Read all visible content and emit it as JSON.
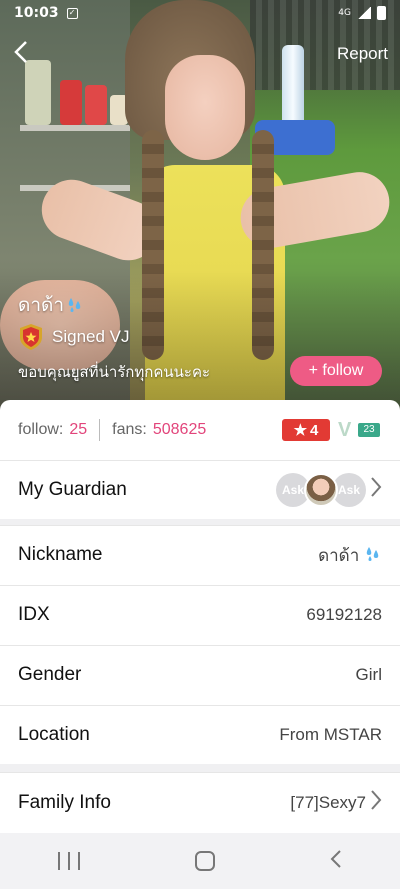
{
  "status_bar": {
    "time": "10:03",
    "network": "4G"
  },
  "header": {
    "report_label": "Report"
  },
  "profile_hero": {
    "nickname": "ดาด้า",
    "vj_label": "Signed VJ",
    "bio": "ขอบคุณยูสที่น่ารักทุกคนนะคะ",
    "follow_label": "+ follow"
  },
  "stats": {
    "follow_label": "follow:",
    "follow_count": "25",
    "fans_label": "fans:",
    "fans_count": "508625",
    "level": "4",
    "vip_level": "23"
  },
  "guardian": {
    "label": "My Guardian",
    "ask_label": "Ask"
  },
  "info_rows": {
    "nickname": {
      "label": "Nickname",
      "value": "ดาด้า"
    },
    "idx": {
      "label": "IDX",
      "value": "69192128"
    },
    "gender": {
      "label": "Gender",
      "value": "Girl"
    },
    "location": {
      "label": "Location",
      "value": "From MSTAR"
    },
    "family": {
      "label": "Family Info",
      "value": "[77]Sexy7"
    }
  },
  "colors": {
    "accent_pink": "#e2457b",
    "follow_button": "#ee5b85",
    "level_badge": "#e23a34",
    "vip_badge": "#3aa88a"
  }
}
